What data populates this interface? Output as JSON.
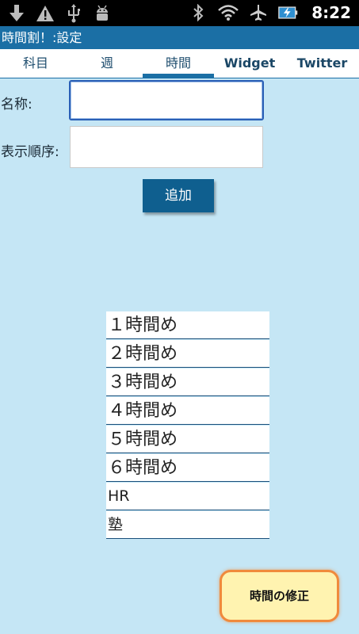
{
  "status_bar": {
    "left_icons": [
      "download-icon",
      "warning-icon",
      "usb-icon",
      "android-debug-icon"
    ],
    "right_icons": [
      "bluetooth-icon",
      "wifi-icon",
      "airplane-icon",
      "battery-charging-icon"
    ],
    "time": "8:22"
  },
  "title": "時間割！:設定",
  "tabs": [
    {
      "label": "科目",
      "active": false
    },
    {
      "label": "週",
      "active": false
    },
    {
      "label": "時間",
      "active": true
    },
    {
      "label": "Widget",
      "active": false
    },
    {
      "label": "Twitter",
      "active": false
    }
  ],
  "form": {
    "name_label": "名称:",
    "name_value": "",
    "order_label": "表示順序:",
    "order_value": "",
    "add_button": "追加"
  },
  "list": {
    "items": [
      "１時間め",
      "２時間め",
      "３時間め",
      "４時間め",
      "５時間め",
      "６時間め",
      "HR",
      "塾"
    ]
  },
  "fix_button": "時間の修正",
  "colors": {
    "background": "#c5e6f5",
    "title_bar": "#1b6fa5",
    "button": "#0f5f8f",
    "fix_button_bg": "#fff3b0",
    "fix_button_border": "#f08a3c"
  }
}
